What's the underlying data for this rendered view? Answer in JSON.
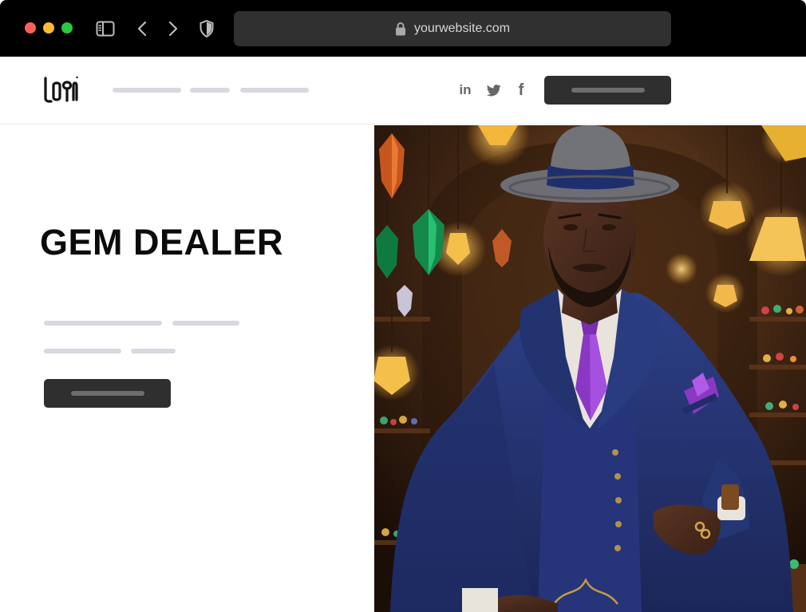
{
  "browser": {
    "url": "yourwebsite.com",
    "icons": [
      "close-dot",
      "minimize-dot",
      "zoom-dot",
      "sidebar-icon",
      "chevron-left-icon",
      "chevron-right-icon",
      "shield-icon",
      "lock-icon"
    ]
  },
  "navbar": {
    "logo_text": "LOGO",
    "social": {
      "linkedin": "in",
      "facebook": "f"
    }
  },
  "hero": {
    "title": "GEM DEALER"
  },
  "colors": {
    "chrome": "#000000",
    "address_bar": "#303030",
    "placeholder_line": "#d8d8e0",
    "button": "#2f2f2f",
    "title": "#0b0b0b"
  }
}
